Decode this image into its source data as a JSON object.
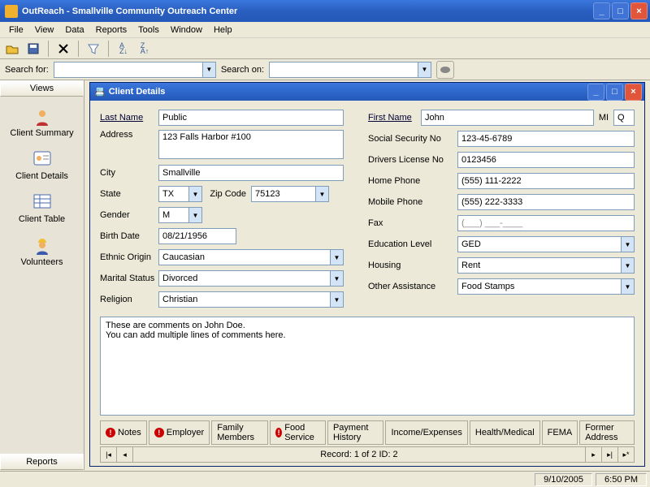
{
  "window": {
    "title": "OutReach - Smallville Community Outreach Center"
  },
  "menu": {
    "file": "File",
    "view": "View",
    "data": "Data",
    "reports": "Reports",
    "tools": "Tools",
    "window": "Window",
    "help": "Help"
  },
  "search": {
    "for_label": "Search for:",
    "for_value": "",
    "on_label": "Search on:",
    "on_value": ""
  },
  "sidebar": {
    "views_header": "Views",
    "reports_header": "Reports",
    "items": [
      {
        "label": "Client Summary"
      },
      {
        "label": "Client Details"
      },
      {
        "label": "Client Table"
      },
      {
        "label": "Volunteers"
      }
    ]
  },
  "mdi": {
    "title": "Client Details"
  },
  "client": {
    "last_name_label": "Last Name",
    "last_name": "Public",
    "first_name_label": "First Name",
    "first_name": "John",
    "mi_label": "MI",
    "mi": "Q",
    "address_label": "Address",
    "address": "123 Falls Harbor #100",
    "city_label": "City",
    "city": "Smallville",
    "state_label": "State",
    "state": "TX",
    "zip_label": "Zip Code",
    "zip": "75123",
    "gender_label": "Gender",
    "gender": "M",
    "birth_label": "Birth Date",
    "birth": "08/21/1956",
    "ethnic_label": "Ethnic Origin",
    "ethnic": "Caucasian",
    "marital_label": "Marital Status",
    "marital": "Divorced",
    "religion_label": "Religion",
    "religion": "Christian",
    "ssn_label": "Social Security No",
    "ssn": "123-45-6789",
    "dl_label": "Drivers License No",
    "dl": "0123456",
    "home_label": "Home Phone",
    "home": "(555) 111-2222",
    "mobile_label": "Mobile Phone",
    "mobile": "(555) 222-3333",
    "fax_label": "Fax",
    "fax": "(___) ___-____",
    "edu_label": "Education Level",
    "edu": "GED",
    "housing_label": "Housing",
    "housing": "Rent",
    "assist_label": "Other Assistance",
    "assist": "Food Stamps"
  },
  "comments": "These are comments on John Doe.\nYou can add multiple lines of comments here.",
  "tabs": {
    "notes": "Notes",
    "employer": "Employer",
    "family": "Family Members",
    "food": "Food Service",
    "payment": "Payment History",
    "income": "Income/Expenses",
    "health": "Health/Medical",
    "fema": "FEMA",
    "former": "Former Address"
  },
  "recordnav": {
    "text": "Record: 1 of 2     ID: 2"
  },
  "status": {
    "date": "9/10/2005",
    "time": "6:50 PM"
  }
}
